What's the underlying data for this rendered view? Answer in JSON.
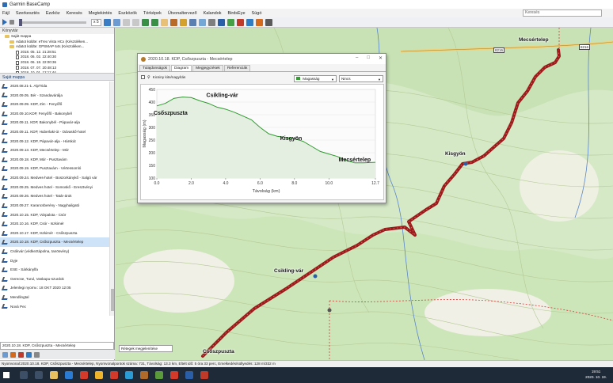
{
  "window": {
    "title": "Garmin BaseCamp"
  },
  "menu": [
    "Fájl",
    "Szerkesztés",
    "Ezzköz",
    "Keresés",
    "Megtekintés",
    "Eszközök",
    "Térképek",
    "Útvonaltervező",
    "Kalandok",
    "BirdsEye",
    "Súgó"
  ],
  "search": {
    "placeholder": "Keresés"
  },
  "toolbar": {
    "speed": "x 5"
  },
  "library": {
    "header": "Könyvtár",
    "tree": [
      {
        "label": "Saját mappa",
        "type": "folder"
      },
      {
        "label": "Adatot küldte: eTrex Vista HCx (Készüléken...",
        "type": "folder"
      },
      {
        "label": "Adatot küldte: GPSMAP 64s (Készüléken...",
        "type": "folder"
      },
      {
        "label": "2018. 05. 12. 21:28:51",
        "type": "doc"
      },
      {
        "label": "2018. 06. 02. 22:40:30",
        "type": "doc"
      },
      {
        "label": "2018. 06. 18. 22:00:36",
        "type": "doc"
      },
      {
        "label": "2018. 07. 07. 20:48:13",
        "type": "doc"
      },
      {
        "label": "2018. 10. 01. 12:11:44",
        "type": "doc"
      },
      {
        "label": "2018. 10. 20. 19:26:13",
        "type": "doc"
      }
    ]
  },
  "section": {
    "title": "Saját mappa"
  },
  "list": [
    "2020.08.21-1. AlpTrida",
    "2020.09.05. Bér - Szandavárálja",
    "2020.09.09. KDP, Zirc - Fenyőfő",
    "2020.09.10.KDP, Fenyőfő - Bakonybél",
    "2020.09.11. KDP, Bakonybél - Pápavár-alja",
    "2020.09.11. KDP, Huberlaki-út - Odvaskő-hotel",
    "2020.09.12. KDP, Pápavár-alja - Hárskút",
    "2020.09.13. KDP, Mecsértelep - Mór",
    "2020.09.18. KDP, Mór - Pusztavám",
    "2020.09.19. KDP, Pusztavám - Vértessomló",
    "2020.09.24. Medves-hotel - Boszorkánykő - Salgó vár",
    "2020.09.25. Medves hotel - Somoskő - Eresztvényi",
    "2020.09.26. Medves hotel - Tatár-árok",
    "2020.09.27. Karancsberény - Nagyhailgató",
    "2020.10.15. KDP, Várpalota - Csór",
    "2020.10.16. KDP, Csór - Iszkimér",
    "2020.10.17. KDP, Iszkimér - Csőszpuszta",
    "2020.10.18. KDP, Csőszpuszta - Mecsértelep",
    "Csókvár (védkeztápolna, tanösvény)",
    "Dyje",
    "ESE - Sárkánylfa",
    "Gerecse, Turul, Vaskapu-szurdok",
    "Jelenlegi nyomv.: 18 OKT 2020 12:05",
    "Mendlingtal",
    "Nová Pec"
  ],
  "selected_index": 17,
  "selection": {
    "value": "2020.10.18. KDP, Csőszpuszta - Mecsértelep"
  },
  "map": {
    "labels": [
      "Mecsértelep",
      "Kisgyön",
      "Csikling-vár",
      "Csőszpuszta"
    ],
    "road_numbers": [
      "8216",
      "8216"
    ],
    "zoom_select": "Rétegek megjelenítése",
    "track_color": "#9b1a1a"
  },
  "status": {
    "text": "Nyomvonal:2020.10.18. KDP, Csőszpuszta - Mecsértelep, Nyomvonalpontok száma: 731, Távolság: 13.3 km, Eltelt idő: 5 óra 33 perc, Emelkedés/süllyedés: 128 m/332 m"
  },
  "taskbar": {
    "time": "19:51",
    "date": "2020. 10. 19."
  },
  "dialog": {
    "title": "2020.10.18. KDP, Csőszpuszta - Mecsértelep",
    "tabs": [
      "Tulajdonságok",
      "Diagram",
      "Megjegyzések",
      "Referenciák"
    ],
    "active_tab": 1,
    "checkbox_label": "Kicsiny kite/nagyítás",
    "combo1": "Magasság",
    "combo2": "Nincs"
  },
  "chart_data": {
    "type": "area",
    "xlabel": "Távolság (km)",
    "ylabel": "Magasság (m)",
    "xlim": [
      0,
      12.7
    ],
    "ylim": [
      100,
      450
    ],
    "xticks": [
      "0.0",
      "2.0",
      "4.0",
      "6.0",
      "8.0",
      "10.0",
      "12.7"
    ],
    "yticks": [
      "100",
      "150",
      "200",
      "250",
      "300",
      "350",
      "400",
      "450"
    ],
    "x": [
      0,
      0.5,
      1.0,
      1.5,
      2.0,
      2.5,
      3.0,
      3.5,
      4.0,
      4.5,
      5.0,
      5.5,
      6.0,
      6.5,
      7.0,
      7.5,
      8.0,
      8.5,
      9.0,
      9.5,
      10.0,
      10.5,
      11.0,
      11.5,
      12.0,
      12.7
    ],
    "y": [
      385,
      395,
      415,
      420,
      418,
      405,
      395,
      380,
      372,
      360,
      345,
      330,
      300,
      275,
      265,
      260,
      255,
      245,
      225,
      205,
      195,
      185,
      170,
      160,
      160,
      162
    ],
    "annotations": [
      {
        "text": "Csikling-vár",
        "x": 3.8,
        "y": 420
      },
      {
        "text": "Csőszpuszta",
        "x": 0.8,
        "y": 350
      },
      {
        "text": "Kisgyön",
        "x": 7.8,
        "y": 250
      },
      {
        "text": "Mecsértelep",
        "x": 11.5,
        "y": 165
      }
    ],
    "line_color": "#2f9a2f",
    "fill_color": "#e4efe1"
  }
}
